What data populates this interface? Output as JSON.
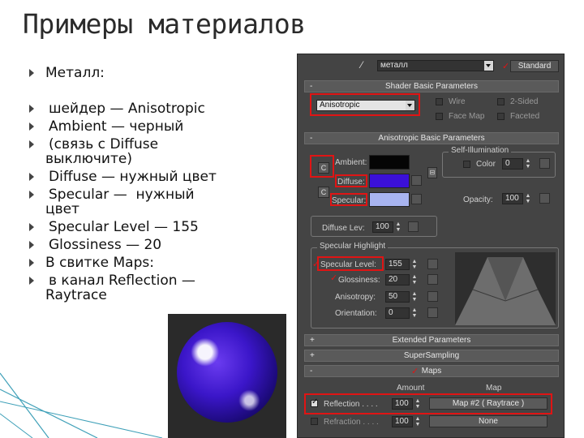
{
  "slide": {
    "title": "Примеры материалов",
    "bullets": [
      "Металл:",
      "шейдер — Anisotropic",
      "Ambient — черный",
      "(связь с Diffuse",
      "выключите)",
      "Diffuse — нужный цвет",
      "Specular —  нужный",
      "цвет",
      "Specular Level — 155",
      "Glossiness — 20",
      "В свитке Maps:",
      "в канал Reflection —",
      "Raytrace"
    ]
  },
  "panel": {
    "material_name": "металл",
    "material_type": "Standard",
    "shader_rollout": {
      "title": "Shader Basic Parameters",
      "toggle": "-",
      "shader": "Anisotropic",
      "wire": "Wire",
      "two_sided": "2-Sided",
      "face_map": "Face Map",
      "faceted": "Faceted"
    },
    "aniso_rollout": {
      "title": "Anisotropic Basic Parameters",
      "toggle": "-",
      "ambient": "Ambient:",
      "diffuse": "Diffuse:",
      "specular": "Specular:",
      "lock_symbol": "C",
      "self_illumination": "Self-Illumination",
      "color": "Color",
      "color_value": "0",
      "opacity": "Opacity:",
      "opacity_value": "100",
      "diffuse_lev": "Diffuse Lev:",
      "diffuse_lev_value": "100",
      "specular_highlight": "Specular Highlight",
      "specular_level": "Specular Level:",
      "specular_level_value": "155",
      "glossiness": "Glossiness:",
      "glossiness_value": "20",
      "anisotropy": "Anisotropy:",
      "anisotropy_value": "50",
      "orientation": "Orientation:",
      "orientation_value": "0"
    },
    "extended": {
      "title": "Extended Parameters",
      "toggle": "+"
    },
    "supersampling": {
      "title": "SuperSampling",
      "toggle": "+"
    },
    "maps": {
      "title": "Maps",
      "toggle": "-",
      "amount_header": "Amount",
      "map_header": "Map",
      "reflection": "Reflection . . . .",
      "reflection_amount": "100",
      "reflection_map": "Map #2  ( Raytrace )",
      "refraction": "Refraction . . . .",
      "refraction_amount": "100",
      "refraction_map": "None"
    }
  },
  "colors": {
    "ambient": "#050505",
    "diffuse": "#3b10d8",
    "specular": "#a8b4f0",
    "highlight": "#e01414"
  }
}
